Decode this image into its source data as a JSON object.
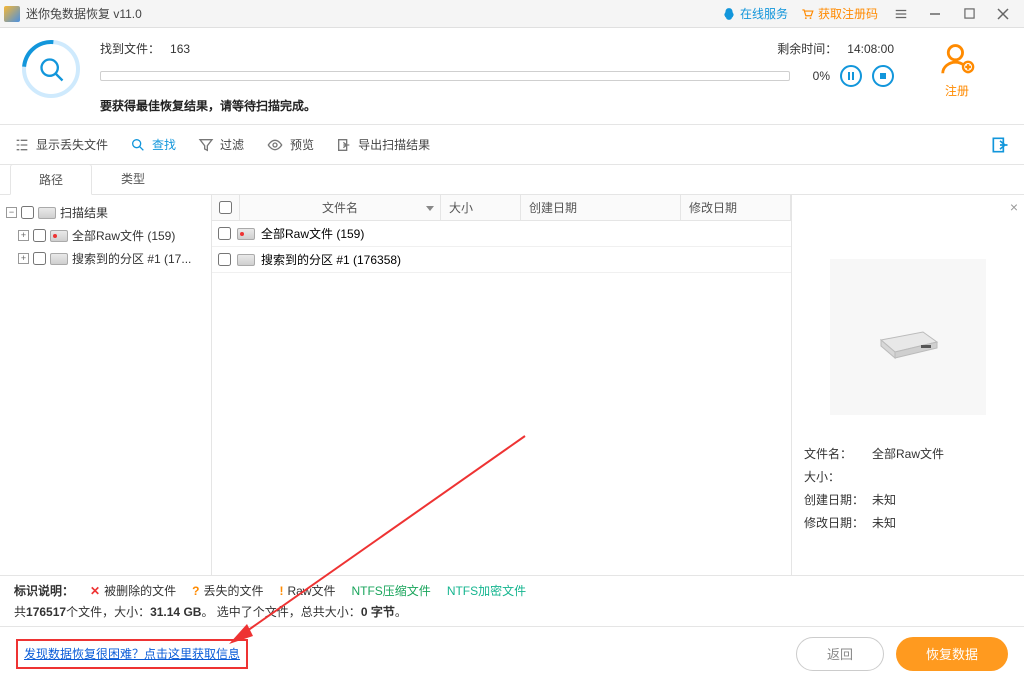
{
  "title": "迷你兔数据恢复 v11.0",
  "titlebar": {
    "online_service": "在线服务",
    "get_reg_code": "获取注册码"
  },
  "scan": {
    "found_label": "找到文件：",
    "found_count": "163",
    "remaining_label": "剩余时间：",
    "remaining_time": "14:08:00",
    "percent": "0%",
    "note": "要获得最佳恢复结果，请等待扫描完成。"
  },
  "register": "注册",
  "toolbar": {
    "show_lost": "显示丢失文件",
    "find": "查找",
    "filter": "过滤",
    "preview": "预览",
    "export": "导出扫描结果"
  },
  "tabs": {
    "path": "路径",
    "type": "类型"
  },
  "tree": {
    "root": "扫描结果",
    "raw": "全部Raw文件 (159)",
    "partition": "搜索到的分区 #1 (17..."
  },
  "columns": {
    "name": "文件名",
    "size": "大小",
    "cdate": "创建日期",
    "mdate": "修改日期"
  },
  "rows": [
    {
      "name": "全部Raw文件 (159)"
    },
    {
      "name": "搜索到的分区 #1 (176358)"
    }
  ],
  "details": {
    "filename_k": "文件名：",
    "filename_v": "全部Raw文件",
    "size_k": "大小：",
    "size_v": "",
    "cdate_k": "创建日期：",
    "cdate_v": "未知",
    "mdate_k": "修改日期：",
    "mdate_v": "未知"
  },
  "legend": {
    "title": "标识说明：",
    "deleted": "被删除的文件",
    "lost": "丢失的文件",
    "raw": "Raw文件",
    "ntfs_comp": "NTFS压缩文件",
    "ntfs_enc": "NTFS加密文件"
  },
  "status": {
    "prefix": "共",
    "total_files": "176517",
    "files_word": "个文件，大小：",
    "total_size": "31.14 GB",
    "mid": "。 选中了",
    "sel_files_suffix": "个文件，总共大小：",
    "sel_size": "0 字节",
    "suffix": "。"
  },
  "help_link": "发现数据恢复很困难？点击这里获取信息",
  "buttons": {
    "back": "返回",
    "recover": "恢复数据"
  }
}
